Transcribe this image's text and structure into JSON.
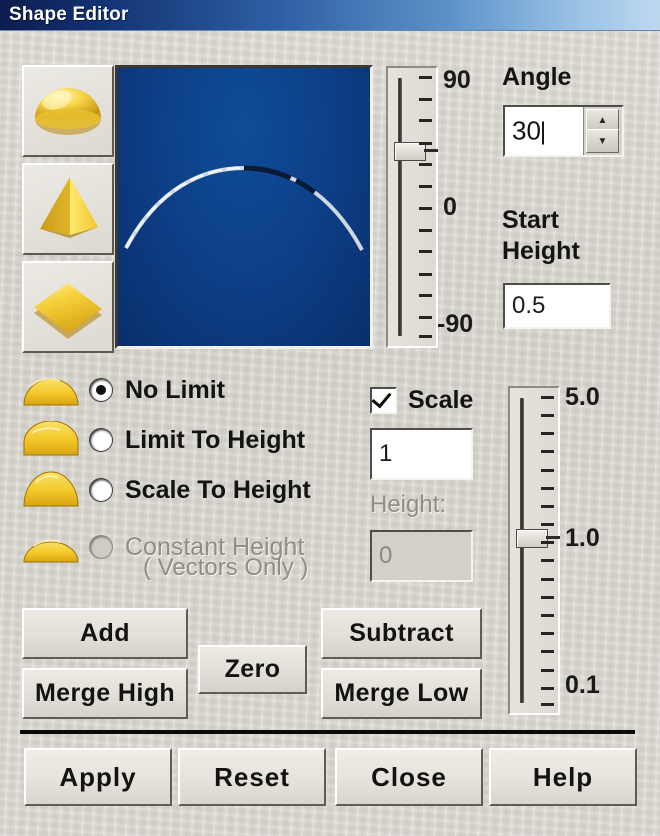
{
  "window": {
    "title": "Shape Editor"
  },
  "shape_presets": [
    {
      "name": "dome-shape",
      "icon": "dome-icon"
    },
    {
      "name": "cone-shape",
      "icon": "pyramid-icon"
    },
    {
      "name": "plane-shape",
      "icon": "diamond-icon"
    }
  ],
  "preview": {
    "name": "shape-profile-preview"
  },
  "angle_slider": {
    "label_top": "90",
    "label_mid": "0",
    "label_bottom": "-90",
    "value": 30,
    "min": -90,
    "max": 90,
    "tick_count": 13
  },
  "angle": {
    "label": "Angle",
    "value": "30",
    "up_arrow": "▲",
    "down_arrow": "▼"
  },
  "start_height": {
    "label_line1": "Start",
    "label_line2": "Height",
    "value": "0.5"
  },
  "limit_options": [
    {
      "label": "No Limit",
      "selected": true,
      "disabled": false
    },
    {
      "label": "Limit To Height",
      "selected": false,
      "disabled": false
    },
    {
      "label": "Scale To Height",
      "selected": false,
      "disabled": false
    },
    {
      "label": "Constant Height",
      "sublabel": "( Vectors Only )",
      "selected": false,
      "disabled": true
    }
  ],
  "scale": {
    "checkbox_label": "Scale",
    "checked": true,
    "value": "1",
    "height_label": "Height:",
    "height_value": "0",
    "height_disabled": true
  },
  "scale_slider": {
    "label_top": "5.0",
    "label_mid": "1.0",
    "label_bottom": "0.1",
    "value": 1.0,
    "min": 0.1,
    "max": 5.0,
    "tick_count": 18
  },
  "operations": {
    "add": "Add",
    "subtract": "Subtract",
    "zero": "Zero",
    "merge_high": "Merge High",
    "merge_low": "Merge Low"
  },
  "footer": {
    "apply": "Apply",
    "reset": "Reset",
    "close": "Close",
    "help": "Help"
  },
  "colors": {
    "title_start": "#0d1c4d",
    "title_end": "#bcd8ef",
    "preview_bg": "#0d4089",
    "face": "#d9d6cf",
    "gold": "#f5cf3d"
  }
}
